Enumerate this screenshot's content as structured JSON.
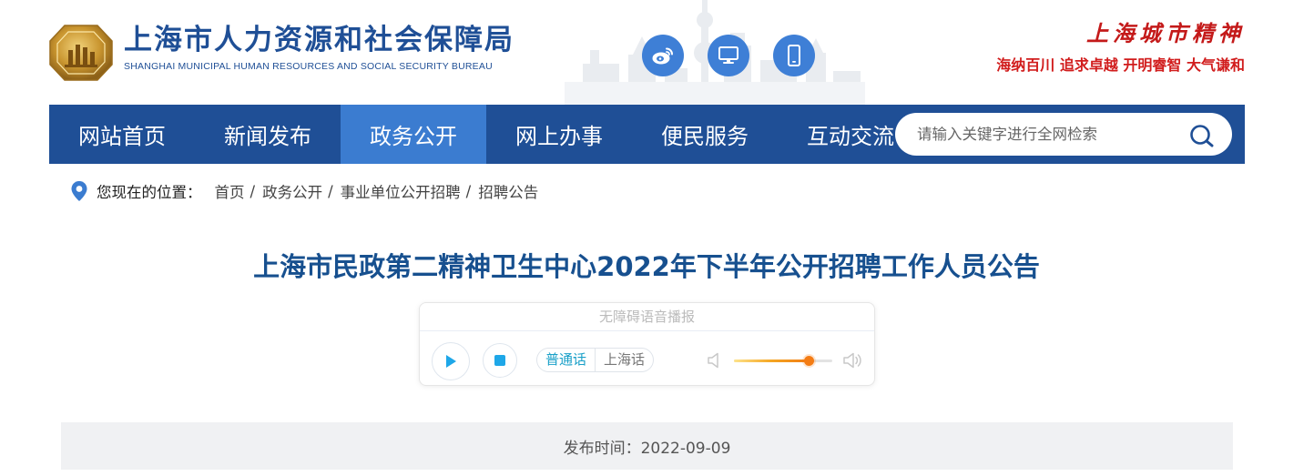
{
  "header": {
    "site_name_cn": "上海市人力资源和社会保障局",
    "site_name_en": "SHANGHAI MUNICIPAL HUMAN RESOURCES AND SOCIAL SECURITY BUREAU",
    "spirit_title": "上海城市精神",
    "spirit_slogan": "海纳百川  追求卓越  开明睿智  大气谦和",
    "social_icons": [
      "weibo-icon",
      "desktop-icon",
      "mobile-icon"
    ]
  },
  "nav": {
    "items": [
      "网站首页",
      "新闻发布",
      "政务公开",
      "网上办事",
      "便民服务",
      "互动交流"
    ],
    "active_index": 2
  },
  "search": {
    "placeholder": "请输入关键字进行全网检索"
  },
  "breadcrumb": {
    "label": "您现在的位置：",
    "items": [
      "首页",
      "政务公开",
      "事业单位公开招聘",
      "招聘公告"
    ]
  },
  "article": {
    "title": "上海市民政第二精神卫生中心2022年下半年公开招聘工作人员公告",
    "publish_time": "发布时间：2022-09-09"
  },
  "player": {
    "title": "无障碍语音播报",
    "languages": [
      "普通话",
      "上海话"
    ],
    "active_language_index": 0,
    "volume_fraction": 0.76
  },
  "colors": {
    "brand_blue": "#1f4f96",
    "nav_active": "#3b7cd0",
    "title_blue": "#17508f",
    "spirit_red": "#c41a1a",
    "accent_cyan": "#1aa0c8",
    "volume_orange": "#f47c14"
  }
}
